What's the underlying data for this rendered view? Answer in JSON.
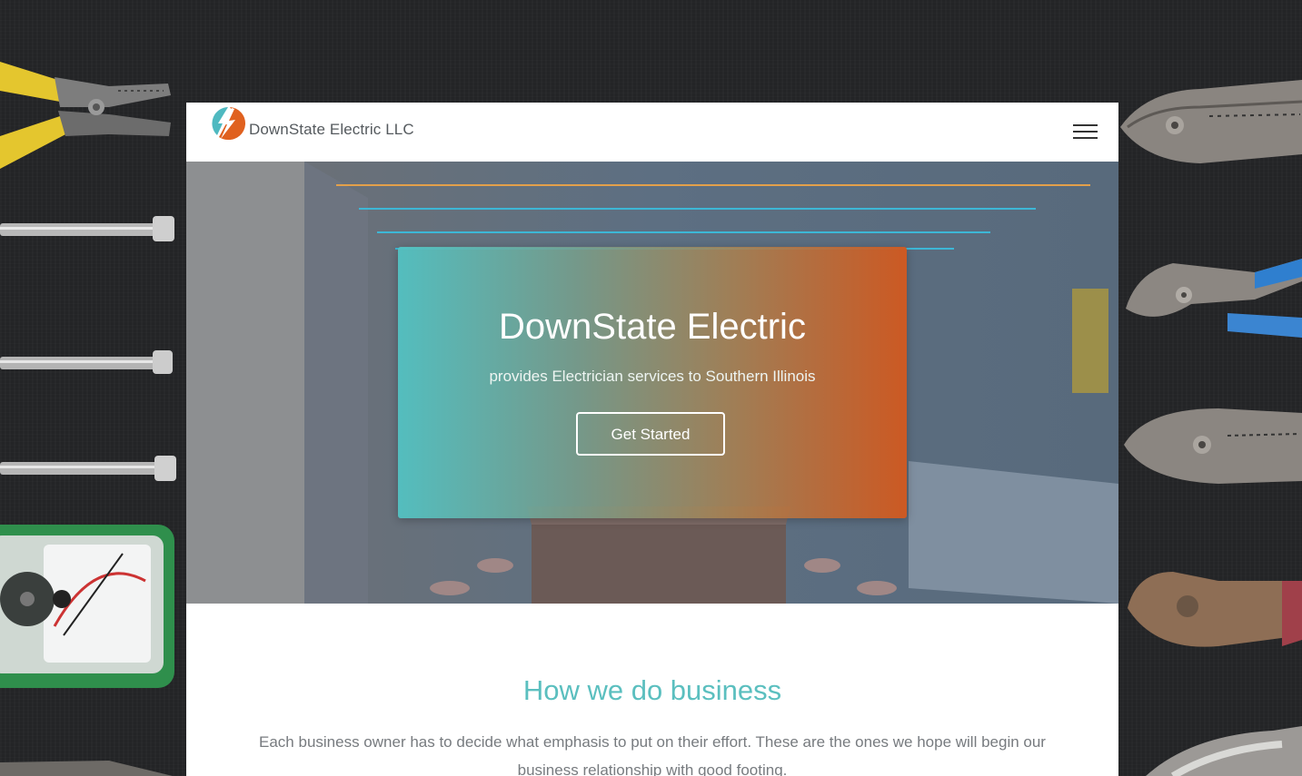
{
  "brand": {
    "name": "DownState Electric LLC",
    "logo_icon": "lightning-bolt-icon",
    "logo_colors": [
      "#4fb9c0",
      "#e0611f"
    ]
  },
  "nav": {
    "menu_icon": "hamburger-menu-icon"
  },
  "hero": {
    "title": "DownState Electric",
    "subtitle": "provides Electrician services to Southern Illinois",
    "button_label": "Get Started",
    "gradient": [
      "#52c4c4",
      "#d2581e"
    ]
  },
  "business": {
    "title": "How we do business",
    "text": "Each business owner has to decide what emphasis to put on their effort. These are the ones we hope will begin our business relationship with good footing."
  },
  "colors": {
    "accent": "#5bbfbf",
    "orange": "#d2581e"
  }
}
